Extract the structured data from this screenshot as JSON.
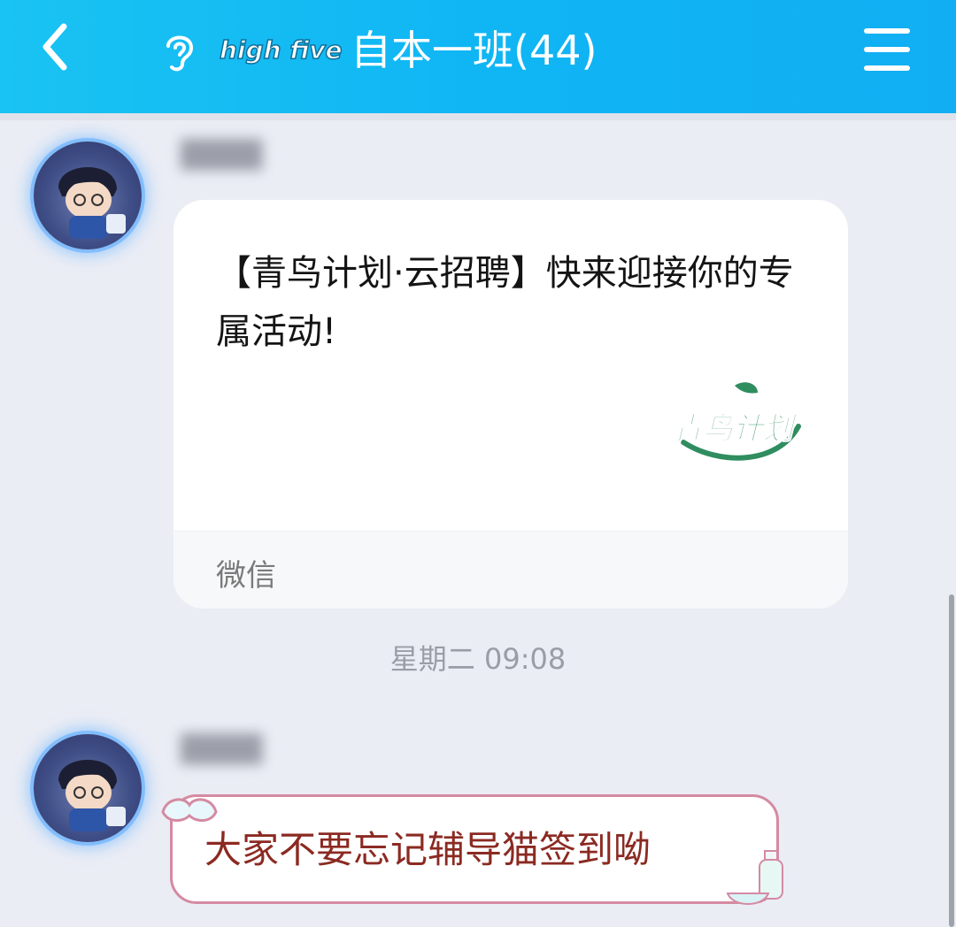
{
  "header": {
    "title": "自本一班(44)",
    "logo_text": "high five",
    "background_color": "#13b6f4"
  },
  "messages": [
    {
      "type": "share_card",
      "card": {
        "text": "【青鸟计划·云招聘】快来迎接你的专属活动!",
        "source": "微信",
        "thumbnail_text": "青鸟计划"
      }
    },
    {
      "type": "timestamp",
      "text": "星期二 09:08"
    },
    {
      "type": "text",
      "text": "大家不要忘记辅导猫签到呦"
    }
  ],
  "icons": {
    "back": "chevron-left-icon",
    "voice": "ear-icon",
    "menu": "menu-icon"
  }
}
